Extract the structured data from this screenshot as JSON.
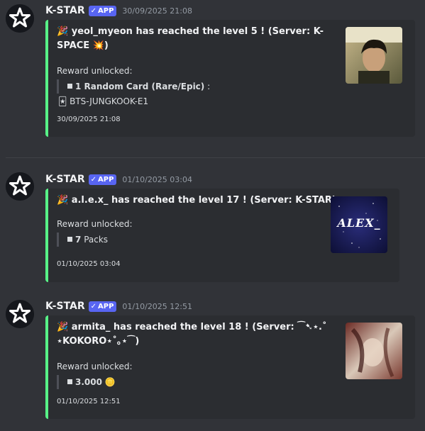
{
  "messages": [
    {
      "username": "K-STAR",
      "badge": "APP",
      "timestamp": "30/09/2025 21:08",
      "title_emoji": "🎉",
      "title_line1": "yeol_myeon has reached the level 5 ! (Server: K-",
      "title_line2": "SPACE 💥)",
      "reward_label": "Reward unlocked:",
      "reward_item": "1 Random Card (Rare/Epic)",
      "reward_item_suffix": ":",
      "card_icon": "🃏",
      "card_name": "BTS-JUNGKOOK-E1",
      "footer": "30/09/2025 21:08"
    },
    {
      "username": "K-STAR",
      "badge": "APP",
      "timestamp": "01/10/2025 03:04",
      "title_emoji": "🎉",
      "title_line1": "a.l.e.x_ has reached the level 17 ! (Server: K-STAR)",
      "reward_label": "Reward unlocked:",
      "reward_count": "7",
      "reward_unit": "Packs",
      "thumb_text": "ALEX_",
      "footer": "01/10/2025 03:04"
    },
    {
      "username": "K-STAR",
      "badge": "APP",
      "timestamp": "01/10/2025 12:51",
      "title_emoji": "🎉",
      "title_line1": "armita_ has reached the level 18 ! (Server: ⁀➷⋆.˚",
      "title_line2": "⋆KOKORO⋆˚｡⋆⁀)",
      "reward_label": "Reward unlocked:",
      "reward_amount": "3.000",
      "coin_icon": "🪙",
      "footer": "01/10/2025 12:51"
    }
  ],
  "colors": {
    "accent": "#57f287",
    "badge": "#5865f2",
    "background": "#313338",
    "embed": "#2b2d31"
  }
}
